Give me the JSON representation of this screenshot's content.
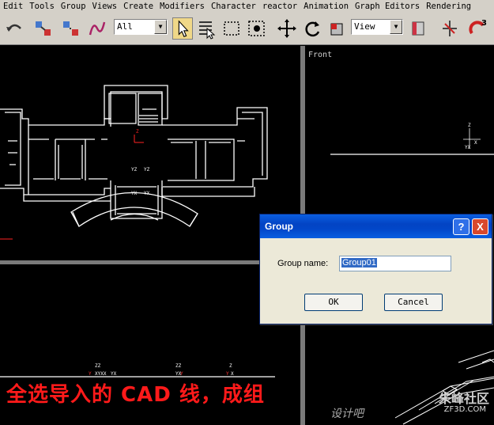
{
  "menu": [
    "Edit",
    "Tools",
    "Group",
    "Views",
    "Create",
    "Modifiers",
    "Character",
    "reactor",
    "Animation",
    "Graph Editors",
    "Rendering"
  ],
  "toolbar": {
    "selection_filter": "All",
    "reference_coord": "View",
    "snap_badge": "3"
  },
  "viewports": {
    "front_label": "Front"
  },
  "dialog": {
    "title": "Group",
    "help_symbol": "?",
    "close_symbol": "X",
    "group_name_label": "Group name:",
    "group_name_value": "Group01",
    "ok_label": "OK",
    "cancel_label": "Cancel"
  },
  "caption": "全选导入的 CAD 线，成组",
  "watermark": {
    "brand": "朱峰社区",
    "site_cn": "设计吧",
    "url": "ZF3D.COM"
  },
  "colors": {
    "chrome": "#d4d0c8",
    "viewport_bg": "#000000",
    "drawing_line": "#ffffff",
    "caption_red": "#ff1a1a",
    "title_blue": "#0a5ee0"
  }
}
